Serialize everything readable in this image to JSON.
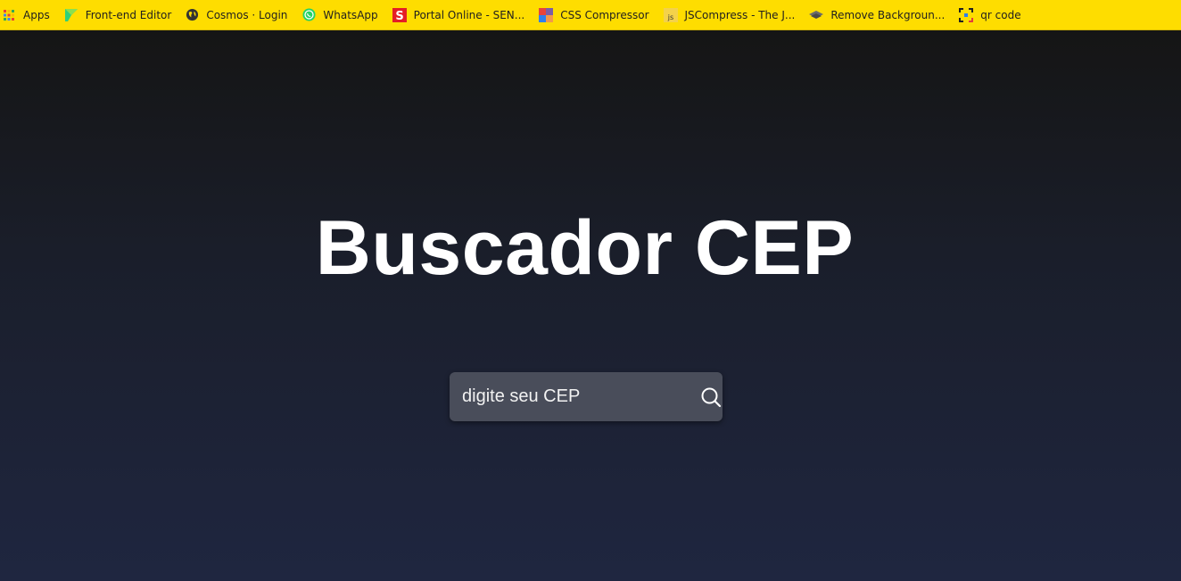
{
  "bookmarks": [
    {
      "label": "Apps",
      "icon": "apps-grid-icon"
    },
    {
      "label": "Front-end Editor",
      "icon": "frontend-editor-icon"
    },
    {
      "label": "Cosmos · Login",
      "icon": "globe-icon"
    },
    {
      "label": "WhatsApp",
      "icon": "whatsapp-icon"
    },
    {
      "label": "Portal Online - SEN...",
      "icon": "senac-icon"
    },
    {
      "label": "CSS Compressor",
      "icon": "css-compressor-icon"
    },
    {
      "label": "JSCompress - The J...",
      "icon": "js-icon"
    },
    {
      "label": "Remove Backgroun...",
      "icon": "remove-bg-icon"
    },
    {
      "label": "qr code",
      "icon": "qr-code-icon"
    }
  ],
  "page": {
    "title": "Buscador CEP"
  },
  "search": {
    "placeholder": "digite seu CEP",
    "value": ""
  },
  "colors": {
    "bookmarks_bar": "#fedd00",
    "background_top": "#151515",
    "background_bottom": "#1f2640",
    "search_box": "#494d5a",
    "title_text": "#ffffff"
  }
}
